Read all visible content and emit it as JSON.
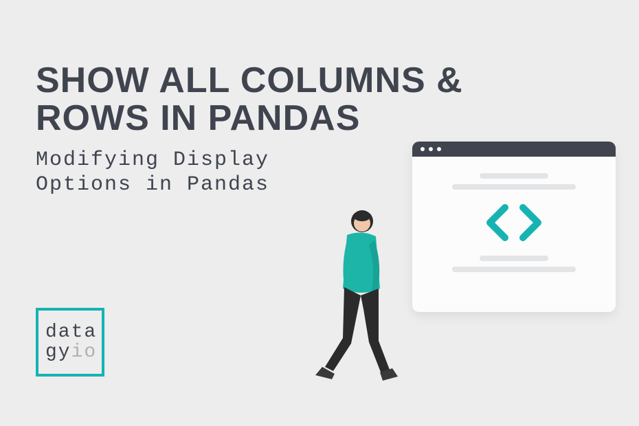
{
  "title": "SHOW ALL COLUMNS & ROWS IN PANDAS",
  "subtitle": "Modifying Display Options in Pandas",
  "logo": {
    "line1": "data",
    "line2_a": "gy",
    "line2_b": "io"
  },
  "colors": {
    "teal": "#17b3b3",
    "dark": "#3f444f",
    "bg": "#ededed"
  }
}
